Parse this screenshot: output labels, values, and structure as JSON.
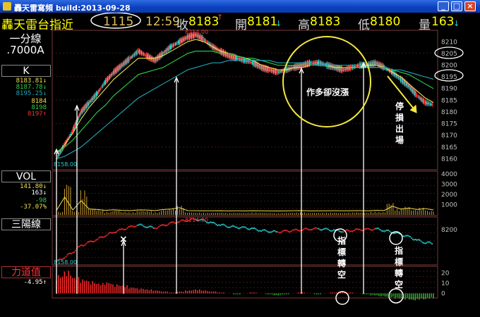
{
  "window": {
    "title": "轟天雷寫頻 build:2013-09-28",
    "min_label": "_",
    "max_label": "□",
    "close_label": "×"
  },
  "quote": {
    "name": "轟天雷台指近",
    "tick_count": "1115",
    "time": "12:59",
    "close_label": "收",
    "close_value": "8183",
    "close_mark": "↑",
    "open_label": "開",
    "open_value": "8181",
    "open_mark": "↓",
    "high_label": "高",
    "high_value": "8183",
    "low_label": "低",
    "low_value": "8180",
    "vol_label": "量",
    "vol_value": "163",
    "vol_mark": "↓"
  },
  "left": {
    "period": "一分線",
    "param": ".7000A",
    "k_label": "K",
    "k_values": [
      "8183.81↓",
      "8187.78↓",
      "8195.25↓"
    ],
    "k_values2": [
      "8184",
      "8198",
      "8197↑"
    ],
    "vol_label": "VOL",
    "vol_values": [
      "141.80↓",
      "163↓"
    ],
    "vol_values2": [
      "-98",
      "-37.07%"
    ],
    "sanyang_label": "三陽線",
    "force_label": "力道值",
    "force_value": "-4.95↑"
  },
  "colors": {
    "up": "#ff2a2a",
    "down": "#22d4d4",
    "ma_fast": "#f0e04a",
    "ma_mid": "#2fd24a",
    "ma_slow": "#20a8b8",
    "annotation": "#f4e83c",
    "grid": "#7a3a3a"
  },
  "chart_data": {
    "type": "line",
    "kline": {
      "high_label": "8214.00",
      "low_label": "8158.00",
      "yticks": [
        8210,
        8205,
        8200,
        8195,
        8190,
        8185,
        8180,
        8175,
        8170,
        8165,
        8160
      ],
      "ylim": [
        8158,
        8214
      ],
      "close_path": [
        8160,
        8166,
        8172,
        8180,
        8184,
        8188,
        8193,
        8197,
        8200,
        8203,
        8206,
        8204,
        8202,
        8205,
        8208,
        8210,
        8212,
        8213,
        8211,
        8208,
        8206,
        8204,
        8203,
        8202,
        8201,
        8199,
        8198,
        8197,
        8198,
        8199,
        8200,
        8201,
        8201,
        8200,
        8199,
        8198,
        8199,
        8200,
        8200,
        8201,
        8199,
        8197,
        8194,
        8191,
        8187,
        8184,
        8183
      ],
      "ma_fast": [
        8162,
        8166,
        8171,
        8177,
        8182,
        8186,
        8190,
        8194,
        8197,
        8200,
        8203,
        8203,
        8203,
        8204,
        8206,
        8208,
        8210,
        8211,
        8210,
        8208,
        8206,
        8205,
        8204,
        8203,
        8202,
        8200,
        8199,
        8198,
        8198,
        8199,
        8199,
        8200,
        8200,
        8200,
        8199,
        8199,
        8199,
        8199,
        8200,
        8200,
        8199,
        8197,
        8195,
        8192,
        8189,
        8186,
        8184
      ],
      "ma_mid": [
        8163,
        8165,
        8168,
        8172,
        8176,
        8180,
        8183,
        8187,
        8190,
        8193,
        8196,
        8197,
        8198,
        8199,
        8201,
        8203,
        8205,
        8206,
        8206,
        8206,
        8205,
        8205,
        8204,
        8203,
        8203,
        8202,
        8201,
        8200,
        8200,
        8200,
        8200,
        8200,
        8200,
        8200,
        8200,
        8199,
        8199,
        8199,
        8199,
        8199,
        8199,
        8198,
        8197,
        8196,
        8194,
        8192,
        8190
      ],
      "ma_slow": [
        8160,
        8161,
        8163,
        8165,
        8168,
        8171,
        8174,
        8177,
        8180,
        8183,
        8186,
        8188,
        8190,
        8192,
        8194,
        8196,
        8198,
        8199,
        8200,
        8201,
        8201,
        8202,
        8202,
        8202,
        8202,
        8202,
        8202,
        8201,
        8201,
        8201,
        8201,
        8201,
        8200,
        8200,
        8200,
        8200,
        8200,
        8200,
        8199,
        8199,
        8199,
        8198,
        8198,
        8197,
        8196,
        8195,
        8194
      ]
    },
    "volume": {
      "yticks": [
        4000,
        3000,
        2000,
        1000
      ],
      "ylim": [
        0,
        4200
      ],
      "values": [
        300,
        3200,
        400,
        2400,
        600,
        500,
        300,
        450,
        300,
        260,
        400,
        380,
        260,
        500,
        600,
        900,
        250,
        230,
        210,
        220,
        230,
        200,
        210,
        190,
        240,
        220,
        200,
        180,
        200,
        230,
        250,
        200,
        210,
        220,
        230,
        210,
        240,
        260,
        220,
        300,
        280,
        1200,
        600,
        800,
        500,
        700,
        400
      ]
    },
    "sanyang": {
      "high_label": "8214.00",
      "low_label": "8158.00",
      "yticks": [
        8200
      ],
      "ylim": [
        8158,
        8214
      ]
    },
    "force": {
      "yticks": [
        20,
        10,
        0
      ],
      "ylim": [
        -12,
        25
      ],
      "values": [
        18,
        22,
        16,
        14,
        12,
        10,
        11,
        9,
        8,
        6,
        5,
        4,
        3,
        2,
        1,
        2,
        3,
        4,
        3,
        2,
        1,
        0,
        -1,
        0,
        1,
        0,
        -1,
        -2,
        -1,
        0,
        1,
        0,
        -1,
        0,
        1,
        2,
        1,
        0,
        -1,
        -2,
        -3,
        -4,
        -5,
        -6,
        -7,
        -6,
        -5
      ]
    }
  },
  "annotations": {
    "circle_text": "作多卻沒漲",
    "stop_text": "停損出場",
    "signal_text_1": "指標轉空",
    "signal_text_2": "指標轉空"
  }
}
